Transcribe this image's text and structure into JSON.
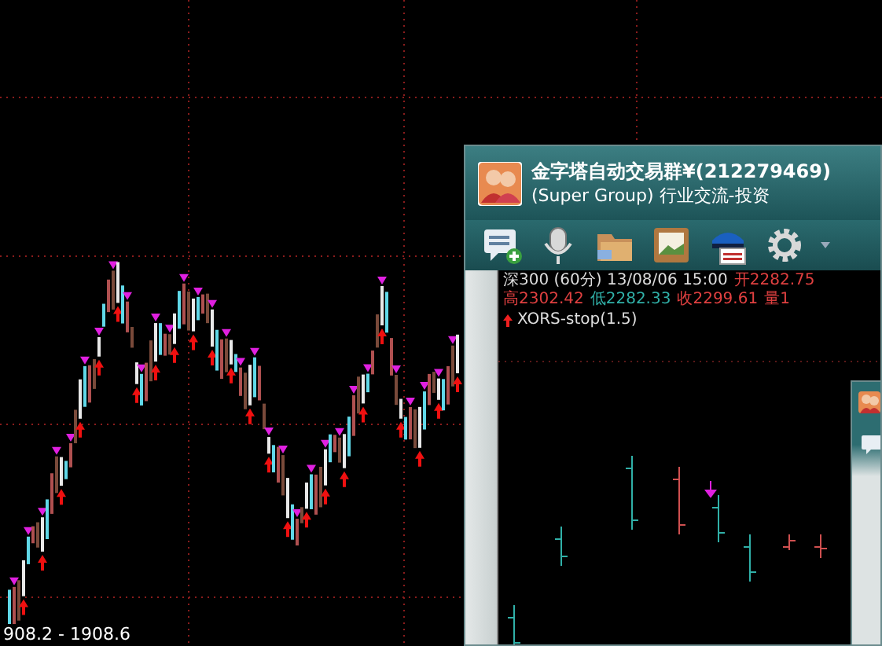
{
  "main_chart": {
    "range_label": "908.2 - 1908.6"
  },
  "chat_window": {
    "title": "金字塔自动交易群¥(212279469)",
    "subtitle": "(Super Group) 行业交流-投资",
    "shared_chart": {
      "heading": "深300 (60分) 13/08/06 15:00",
      "quotes": [
        {
          "text": "开2282.75",
          "color": "#e04040"
        },
        {
          "text": "高2302.42",
          "color": "#e04040"
        },
        {
          "text": "低2282.33",
          "color": "#30b0a8"
        },
        {
          "text": "收2299.61",
          "color": "#e04040"
        },
        {
          "text": "量1",
          "color": "#e04040"
        }
      ],
      "indicator": "XORS-stop(1.5)"
    }
  }
}
